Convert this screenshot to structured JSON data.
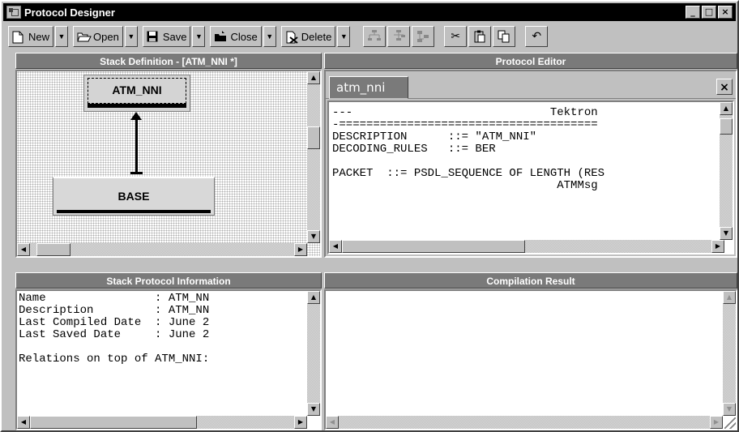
{
  "window": {
    "title": "Protocol Designer"
  },
  "toolbar": {
    "new_label": "New",
    "open_label": "Open",
    "save_label": "Save",
    "close_label": "Close",
    "delete_label": "Delete"
  },
  "stack_definition": {
    "header": "Stack Definition - [ATM_NNI *]",
    "nodes": {
      "top": "ATM_NNI",
      "bottom": "BASE"
    }
  },
  "protocol_editor": {
    "header": "Protocol Editor",
    "tab_label": "atm_nni",
    "code_lines": [
      "---                             Tektron",
      "-======================================",
      "DESCRIPTION      ::= \"ATM_NNI\"",
      "DECODING_RULES   ::= BER",
      "",
      "PACKET  ::= PSDL_SEQUENCE OF LENGTH (RES",
      "                                 ATMMsg"
    ]
  },
  "stack_info": {
    "header": "Stack Protocol Information",
    "lines": [
      "Name                : ATM_NN",
      "Description         : ATM_NN",
      "Last Compiled Date  : June 2",
      "Last Saved Date     : June 2",
      "",
      "Relations on top of ATM_NNI:"
    ]
  },
  "compilation": {
    "header": "Compilation Result"
  }
}
